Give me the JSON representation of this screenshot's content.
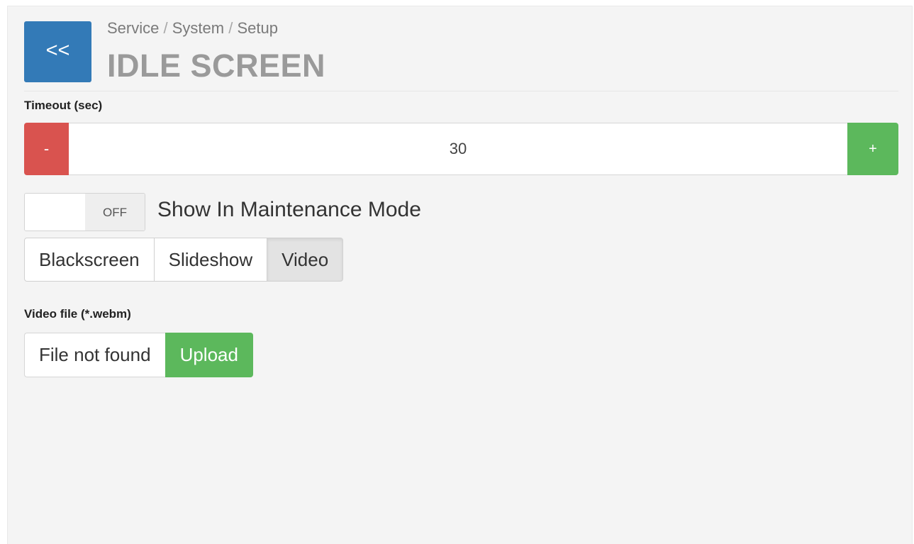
{
  "header": {
    "back_label": "<<",
    "breadcrumb": [
      "Service",
      "System",
      "Setup"
    ],
    "breadcrumb_separator": "/",
    "title": "IDLE SCREEN"
  },
  "timeout": {
    "label": "Timeout (sec)",
    "minus_label": "-",
    "value": "30",
    "plus_label": "+"
  },
  "maintenance_toggle": {
    "state_label": "OFF",
    "is_on": false,
    "label": "Show In Maintenance Mode"
  },
  "modes": {
    "options": [
      "Blackscreen",
      "Slideshow",
      "Video"
    ],
    "selected": "Video"
  },
  "video_file": {
    "label": "Video file (*.webm)",
    "status": "File not found",
    "upload_label": "Upload"
  },
  "colors": {
    "primary": "#337ab7",
    "danger": "#d9534f",
    "success": "#5cb85c",
    "panel_bg": "#f4f4f4"
  },
  "icons": {
    "back": "double-chevron-left-icon"
  }
}
